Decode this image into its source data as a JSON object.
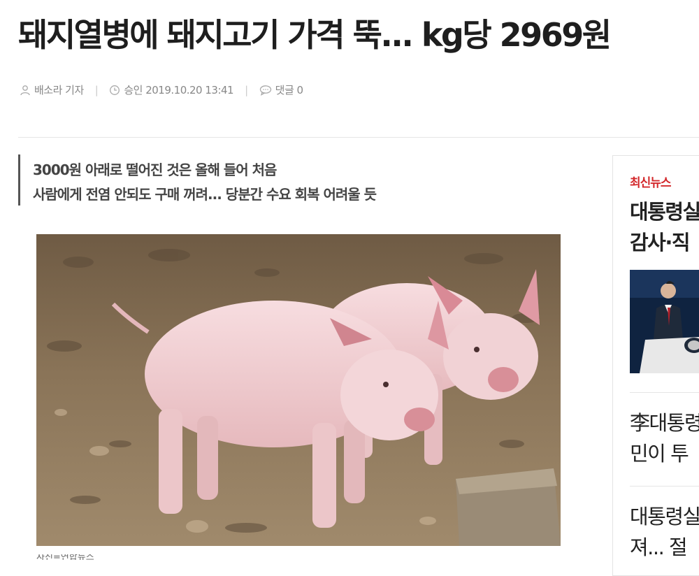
{
  "article": {
    "headline": "돼지열병에 돼지고기 가격 뚝... kg당 2969원",
    "meta": {
      "reporter": "배소라 기자",
      "approved": "승인 2019.10.20 13:41",
      "comments": "댓글 0"
    },
    "summary": [
      "3000원 아래로 떨어진 것은 올해 들어 처음",
      "사람에게 전염 안되도 구매 꺼려... 당분간 수요 회복 어려울 듯"
    ],
    "caption": "사진=연합뉴스"
  },
  "sidebar": {
    "label": "최신뉴스",
    "headline_lines": [
      "대통령실",
      "감사·직"
    ],
    "items": [
      {
        "lines": [
          "李대통령",
          "민이 투"
        ]
      },
      {
        "lines": [
          "대통령실",
          "져... 절"
        ]
      }
    ]
  },
  "icons": {
    "reporter": "user-icon",
    "approved": "clock-icon",
    "comments": "comment-icon"
  },
  "colors": {
    "accent": "#d3282b",
    "meta_text": "#888888",
    "headline_text": "#1e1e1e"
  }
}
